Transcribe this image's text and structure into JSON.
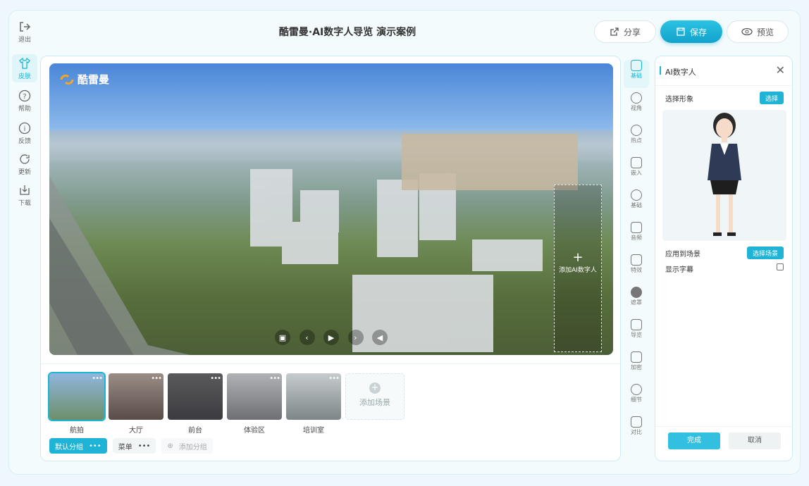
{
  "left_rail": [
    {
      "label": "退出",
      "icon": "exit-icon"
    },
    {
      "label": "皮肤",
      "icon": "shirt-icon"
    },
    {
      "label": "帮助",
      "icon": "help-icon"
    },
    {
      "label": "反馈",
      "icon": "info-icon"
    },
    {
      "label": "更新",
      "icon": "refresh-icon"
    },
    {
      "label": "下载",
      "icon": "download-icon"
    }
  ],
  "header": {
    "title": "酷雷曼·AI数字人导览 演示案例",
    "share": "分享",
    "save": "保存",
    "preview": "预览"
  },
  "pano": {
    "logo": "酷雷曼",
    "add_ai": "添加AI数字人"
  },
  "scenes": [
    {
      "label": "航拍",
      "color": "#6f9fcf"
    },
    {
      "label": "大厅",
      "color": "#7a6a62"
    },
    {
      "label": "前台",
      "color": "#4c4b4e"
    },
    {
      "label": "体验区",
      "color": "#8d8f92"
    },
    {
      "label": "培训室",
      "color": "#9ba3a6"
    }
  ],
  "add_scene": "添加场景",
  "groups": {
    "default": "默认分组",
    "menu": "菜单",
    "add": "添加分组"
  },
  "tools": [
    "基础",
    "视角",
    "热点",
    "嵌入",
    "基础",
    "音频",
    "特效",
    "遮罩",
    "导览",
    "加密",
    "细节",
    "对比"
  ],
  "side": {
    "title": "AI数字人",
    "choose_image": "选择形象",
    "choose_btn": "选择",
    "apply_scene": "应用到场景",
    "choose_scene_btn": "选择场景",
    "show_subtitle": "显示字幕",
    "done": "完成",
    "cancel": "取消"
  },
  "colors": {
    "accent": "#19b6d4"
  }
}
